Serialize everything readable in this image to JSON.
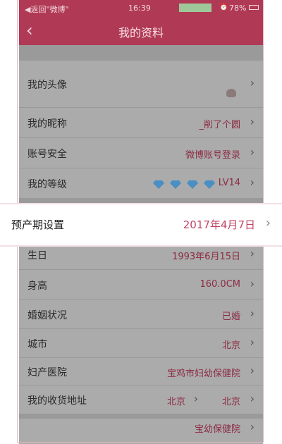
{
  "status": {
    "back_app": "◀返回\"微博\"",
    "time": "16:39",
    "battery": "78%"
  },
  "header": {
    "title": "我的资料"
  },
  "rows": [
    {
      "label": "我的头像",
      "value": ""
    },
    {
      "label": "我的昵称",
      "value": "_削了个圆"
    },
    {
      "label": "账号安全",
      "value": "微博账号登录"
    },
    {
      "label": "我的等级",
      "value": "LV14"
    },
    {
      "label": "预产期设置",
      "value": "2017年4月7日"
    },
    {
      "label": "生日",
      "value": "1993年6月15日"
    },
    {
      "label": "身高",
      "value": "160.0CM"
    },
    {
      "label": "婚姻状况",
      "value": "已婚"
    },
    {
      "label": "城市",
      "value": "北京"
    },
    {
      "label": "妇产医院",
      "value": "宝鸡市妇幼保健院"
    },
    {
      "label": "我的收货地址",
      "value": "北京",
      "value2": "北京"
    },
    {
      "label": "",
      "value": "宝幼保健院"
    }
  ],
  "icons": {
    "back": "chevron-left-icon",
    "chevron": "chevron-right-icon",
    "level": "diamond-icon"
  },
  "colors": {
    "header": "#b03a55",
    "value_text": "#8c2c44",
    "highlight_value": "#c04466"
  }
}
